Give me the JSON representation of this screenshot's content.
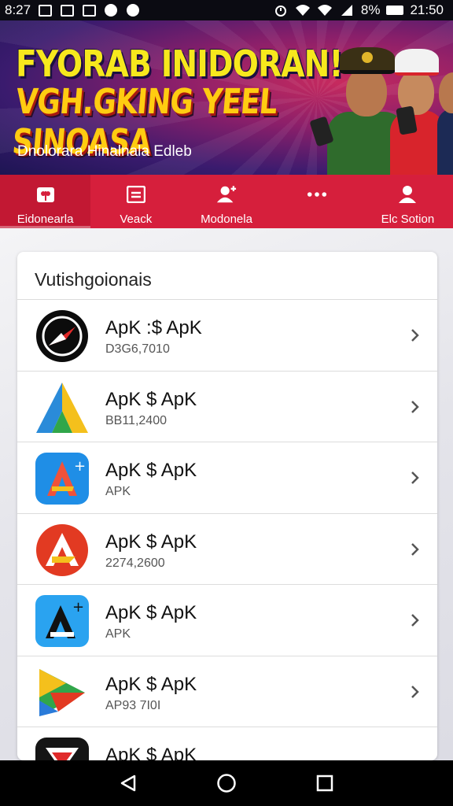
{
  "status_bar": {
    "time_left": "8:27",
    "battery_text": "8%",
    "time_right": "21:50"
  },
  "banner": {
    "title_line1": "FYORAB INIDORAN!",
    "title_line2": "VGH.GKING YEEL SINOASA",
    "subtitle": "Dnolorara Hinalnala Edleb"
  },
  "tabs": [
    {
      "label": "Eidonearla",
      "icon": "gift-icon",
      "active": true
    },
    {
      "label": "Veack",
      "icon": "list-icon",
      "active": false
    },
    {
      "label": "Modonela",
      "icon": "user-add-icon",
      "active": false
    },
    {
      "label": "",
      "icon": "more-dots-icon",
      "active": false
    },
    {
      "label": "Elc Sotion",
      "icon": "user-icon",
      "active": false
    }
  ],
  "section": {
    "title": "Vutishgoionais"
  },
  "apps": [
    {
      "title": "ApK :$ ApK",
      "subtitle": "D3G6,7010",
      "icon": "compass-app-icon"
    },
    {
      "title": "ApK $ ApK",
      "subtitle": "BB11,2400",
      "icon": "triangle-a-app-icon"
    },
    {
      "title": "ApK $ ApK",
      "subtitle": "APK",
      "icon": "blue-a-plus-app-icon"
    },
    {
      "title": "ApK $ ApK",
      "subtitle": "2274,2600",
      "icon": "red-a-app-icon"
    },
    {
      "title": "ApK $ ApK",
      "subtitle": "APK",
      "icon": "blue-a-cross-app-icon"
    },
    {
      "title": "ApK $ ApK",
      "subtitle": "AP93 7I0I",
      "icon": "colorful-a-app-icon"
    },
    {
      "title": "ApK $ ApK",
      "subtitle": "",
      "icon": "dark-app-icon"
    }
  ]
}
